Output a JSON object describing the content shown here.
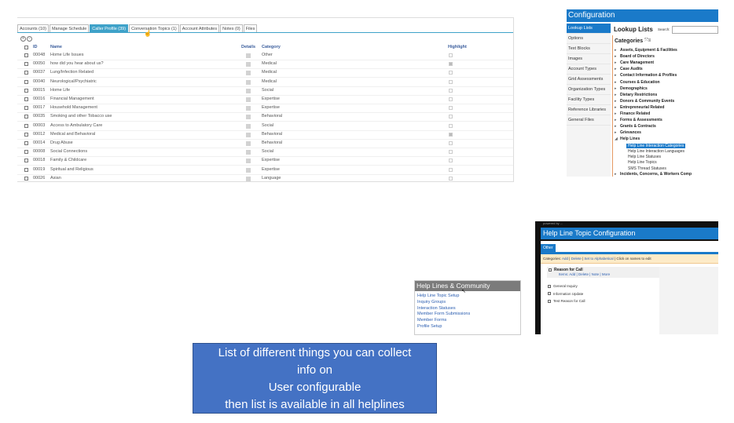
{
  "profile": {
    "tabs": [
      {
        "label": "Accounts (10)",
        "active": false
      },
      {
        "label": "Manage Schedule",
        "active": false
      },
      {
        "label": "Caller Profile (39)",
        "active": true
      },
      {
        "label": "Conversation Topics (1)",
        "active": false
      },
      {
        "label": "Account Attributes",
        "active": false
      },
      {
        "label": "Notes (0)",
        "active": false
      },
      {
        "label": "Files",
        "active": false
      }
    ],
    "columns": {
      "id": "ID",
      "name": "Name",
      "details": "Details",
      "category": "Category",
      "highlight": "Highlight"
    },
    "rows": [
      {
        "id": "00048",
        "name": "Home Life Issues",
        "category": "Other",
        "highlight": false
      },
      {
        "id": "00050",
        "name": "how did you hear about us?",
        "category": "Medical",
        "highlight": true
      },
      {
        "id": "00037",
        "name": "Lung/Infection Related",
        "category": "Medical",
        "highlight": false
      },
      {
        "id": "00040",
        "name": "Neurological/Psychiatric",
        "category": "Medical",
        "highlight": false
      },
      {
        "id": "00015",
        "name": "Home Life",
        "category": "Social",
        "highlight": false
      },
      {
        "id": "00016",
        "name": "Financial Management",
        "category": "Expertise",
        "highlight": false
      },
      {
        "id": "00017",
        "name": "Household Management",
        "category": "Expertise",
        "highlight": false
      },
      {
        "id": "00035",
        "name": "Smoking and other Tobacco use",
        "category": "Behavioral",
        "highlight": false
      },
      {
        "id": "00003",
        "name": "Access to Ambulatory Care",
        "category": "Social",
        "highlight": false
      },
      {
        "id": "00012",
        "name": "Medical and Behavioral",
        "category": "Behavioral",
        "highlight": true
      },
      {
        "id": "00014",
        "name": "Drug Abuse",
        "category": "Behavioral",
        "highlight": false
      },
      {
        "id": "00008",
        "name": "Social Connections",
        "category": "Social",
        "highlight": false
      },
      {
        "id": "00018",
        "name": "Family & Childcare",
        "category": "Expertise",
        "highlight": false
      },
      {
        "id": "00019",
        "name": "Spiritual and Religious",
        "category": "Expertise",
        "highlight": false
      },
      {
        "id": "00026",
        "name": "Asian",
        "category": "Language",
        "highlight": false
      }
    ]
  },
  "config": {
    "title": "Configuration",
    "side_items": [
      {
        "label": "Lookup Lists",
        "active": true
      },
      {
        "label": "Options",
        "active": false
      },
      {
        "label": "Text Blocks",
        "active": false
      },
      {
        "label": "Images",
        "active": false
      },
      {
        "label": "Account Types",
        "active": false
      },
      {
        "label": "Grid Assessments",
        "active": false
      },
      {
        "label": "Organization Types",
        "active": false
      },
      {
        "label": "Facility Types",
        "active": false
      },
      {
        "label": "Reference Libraries",
        "active": false
      },
      {
        "label": "General Files",
        "active": false
      }
    ],
    "lookup_title": "Lookup Lists",
    "search_label": "Search:",
    "categories_title": "Categories",
    "categories": [
      "Assets, Equipment & Facilities",
      "Board of Directors",
      "Care Management",
      "Case Audits",
      "Contact Information & Profiles",
      "Courses & Education",
      "Demographics",
      "Dietary Restrictions",
      "Donors & Community Events",
      "Entrepreneurial Related",
      "Finance Related",
      "Forms & Assessments",
      "Grants & Contracts",
      "Grievances",
      "Help Lines"
    ],
    "help_lines_children": [
      {
        "label": "Help Line Interaction Categories",
        "active": true
      },
      {
        "label": "Help Line Interaction Languages",
        "active": false
      },
      {
        "label": "Help Line Statuses",
        "active": false
      },
      {
        "label": "Help Line Topics",
        "active": false
      },
      {
        "label": "SMS Thread Statuses",
        "active": false
      }
    ],
    "trailing_category": "Incidents, Concerns, & Workers Comp"
  },
  "topic": {
    "top_text": "powered by ...",
    "title": "Help Line Topic Configuration",
    "tab_label": "Other",
    "actions": {
      "prefix": "Categories:",
      "add": "Add",
      "delete": "Delete",
      "alpha": "Set to Alphabetical",
      "hint": "Click on names to edit"
    },
    "section_title": "Reason for Call",
    "section_links": {
      "prefix": "Items:",
      "add": "Add",
      "delete": "Delete",
      "note": "Note",
      "more": "More"
    },
    "items": [
      "General Inquiry",
      "Information Update",
      "Test Reason for Call"
    ]
  },
  "helplines_menu": {
    "title": "Help Lines & Community",
    "items": [
      "Help Line Topic Setup",
      "Inquiry Groups",
      "Interaction Statuses",
      "Member Form Submissions",
      "Member Forms",
      "Profile Setup"
    ]
  },
  "note": {
    "lines": [
      "List of different things you can collect",
      "info on",
      "User configurable",
      "then list is available in all helplines"
    ]
  }
}
